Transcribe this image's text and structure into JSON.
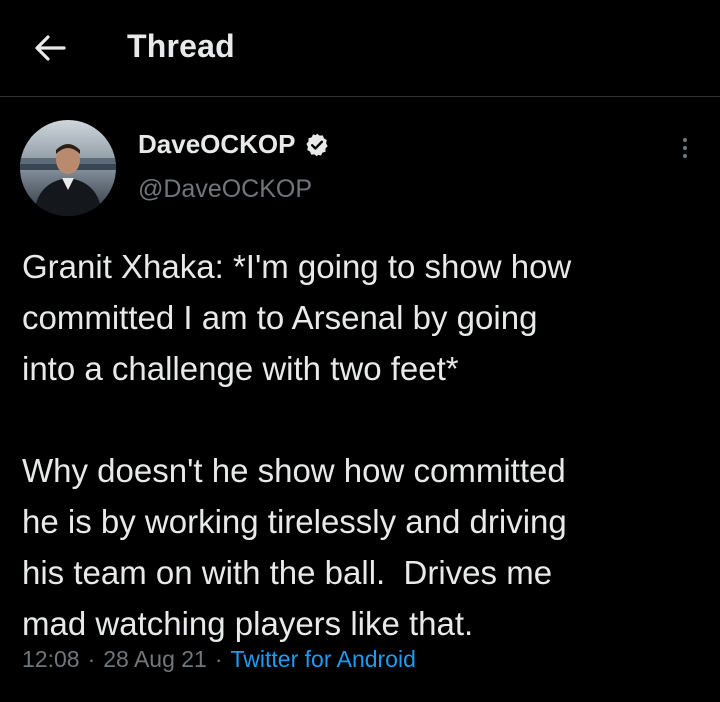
{
  "header": {
    "title": "Thread"
  },
  "tweet": {
    "author": {
      "display_name": "DaveOCKOP",
      "handle": "@DaveOCKOP",
      "verified": true
    },
    "text_paragraph_1": "Granit Xhaka: *I'm going to show how\ncommitted I am to Arsenal by going\ninto a challenge with two feet*",
    "text_paragraph_2": "Why doesn't he show how committed\nhe is by working tirelessly and driving\nhis team on with the ball.  Drives me\nmad watching players like that.",
    "time": "12:08",
    "date": "28 Aug 21",
    "separator": "·",
    "source": "Twitter for Android"
  },
  "icons": {
    "back": "arrow-left-icon",
    "verified": "verified-badge-icon",
    "more": "more-vertical-icon"
  },
  "colors": {
    "background": "#000000",
    "text_primary": "#e7e9ea",
    "text_secondary": "#71767b",
    "accent": "#1d9bf0",
    "divider": "#2f3336"
  }
}
